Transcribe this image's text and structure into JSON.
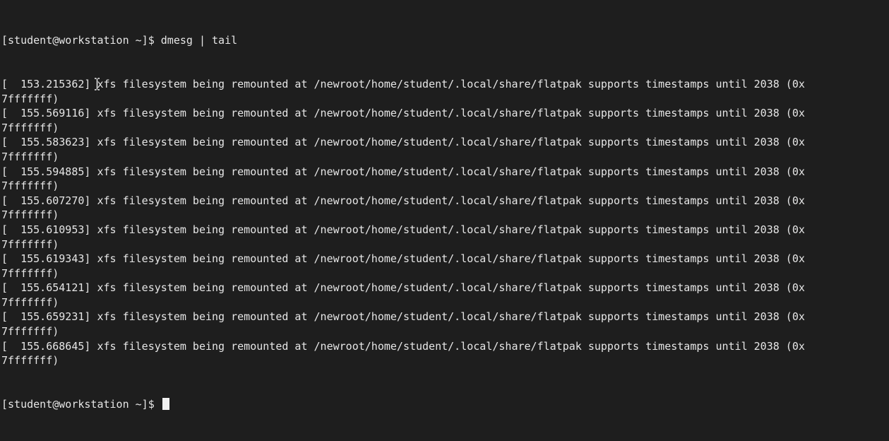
{
  "terminal": {
    "command_line": "[student@workstation ~]$ dmesg | tail",
    "log_lines": [
      {
        "text": "[  153.215362] xfs filesystem being remounted at /newroot/home/student/.local/share/flatpak supports timestamps until 2038 (0x",
        "cont": "7fffffff)"
      },
      {
        "text": "[  155.569116] xfs filesystem being remounted at /newroot/home/student/.local/share/flatpak supports timestamps until 2038 (0x",
        "cont": "7fffffff)"
      },
      {
        "text": "[  155.583623] xfs filesystem being remounted at /newroot/home/student/.local/share/flatpak supports timestamps until 2038 (0x",
        "cont": "7fffffff)"
      },
      {
        "text": "[  155.594885] xfs filesystem being remounted at /newroot/home/student/.local/share/flatpak supports timestamps until 2038 (0x",
        "cont": "7fffffff)"
      },
      {
        "text": "[  155.607270] xfs filesystem being remounted at /newroot/home/student/.local/share/flatpak supports timestamps until 2038 (0x",
        "cont": "7fffffff)"
      },
      {
        "text": "[  155.610953] xfs filesystem being remounted at /newroot/home/student/.local/share/flatpak supports timestamps until 2038 (0x",
        "cont": "7fffffff)"
      },
      {
        "text": "[  155.619343] xfs filesystem being remounted at /newroot/home/student/.local/share/flatpak supports timestamps until 2038 (0x",
        "cont": "7fffffff)"
      },
      {
        "text": "[  155.654121] xfs filesystem being remounted at /newroot/home/student/.local/share/flatpak supports timestamps until 2038 (0x",
        "cont": "7fffffff)"
      },
      {
        "text": "[  155.659231] xfs filesystem being remounted at /newroot/home/student/.local/share/flatpak supports timestamps until 2038 (0x",
        "cont": "7fffffff)"
      },
      {
        "text": "[  155.668645] xfs filesystem being remounted at /newroot/home/student/.local/share/flatpak supports timestamps until 2038 (0x",
        "cont": "7fffffff)"
      }
    ],
    "prompt": "[student@workstation ~]$ ",
    "colors": {
      "background": "#1e1e1e",
      "foreground": "#e6e6e6",
      "cursor": "#f2f2f2"
    },
    "icons": {
      "mouse_pointer": "text-ibeam-cursor-icon",
      "text_cursor": "block-cursor-icon"
    }
  }
}
